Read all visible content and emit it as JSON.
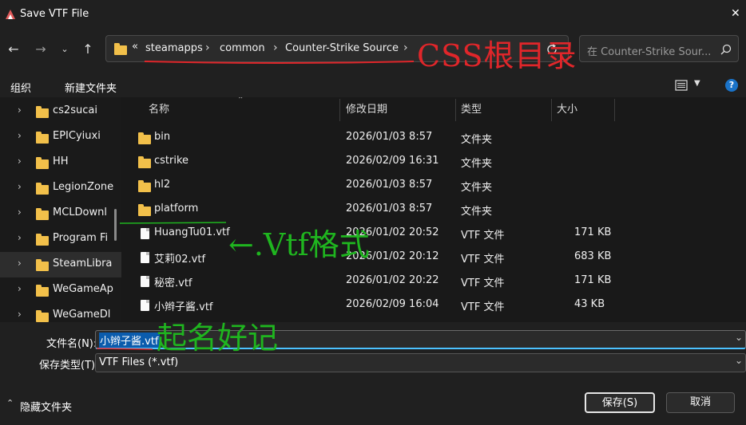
{
  "window": {
    "title": "Save VTF File",
    "close": "✕"
  },
  "nav": {
    "breadcrumbs": [
      "steamapps",
      "common",
      "Counter-Strike Source"
    ],
    "overflow": "«",
    "search_placeholder": "在 Counter-Strike Sour..."
  },
  "toolbar": {
    "organize": "组织",
    "new_folder": "新建文件夹"
  },
  "sidebar": {
    "items": [
      {
        "label": "cs2sucai"
      },
      {
        "label": "EPICyiuxi"
      },
      {
        "label": "HH"
      },
      {
        "label": "LegionZone"
      },
      {
        "label": "MCLDownl"
      },
      {
        "label": "Program Fi"
      },
      {
        "label": "SteamLibra"
      },
      {
        "label": "WeGameAp"
      },
      {
        "label": "WeGameDl"
      }
    ]
  },
  "columns": {
    "name": "名称",
    "date": "修改日期",
    "type": "类型",
    "size": "大小"
  },
  "files": [
    {
      "name": "bin",
      "date": "2026/01/03 8:57",
      "type": "文件夹",
      "size": "",
      "kind": "folder"
    },
    {
      "name": "cstrike",
      "date": "2026/02/09 16:31",
      "type": "文件夹",
      "size": "",
      "kind": "folder"
    },
    {
      "name": "hl2",
      "date": "2026/01/03 8:57",
      "type": "文件夹",
      "size": "",
      "kind": "folder"
    },
    {
      "name": "platform",
      "date": "2026/01/03 8:57",
      "type": "文件夹",
      "size": "",
      "kind": "folder"
    },
    {
      "name": "HuangTu01.vtf",
      "date": "2026/01/02 20:52",
      "type": "VTF 文件",
      "size": "171 KB",
      "kind": "file"
    },
    {
      "name": "艾莉02.vtf",
      "date": "2026/01/02 20:12",
      "type": "VTF 文件",
      "size": "683 KB",
      "kind": "file"
    },
    {
      "name": "秘密.vtf",
      "date": "2026/01/02 20:22",
      "type": "VTF 文件",
      "size": "171 KB",
      "kind": "file"
    },
    {
      "name": "小辫子酱.vtf",
      "date": "2026/02/09 16:04",
      "type": "VTF 文件",
      "size": "43 KB",
      "kind": "file"
    }
  ],
  "form": {
    "filename_label": "文件名(N):",
    "filename_value": "小辫子酱.vtf",
    "filetype_label": "保存类型(T):",
    "filetype_value": "VTF Files (*.vtf)"
  },
  "footer": {
    "hide_folders": "隐藏文件夹",
    "save": "保存(S)",
    "cancel": "取消"
  },
  "annotations": {
    "css_root": "CSS根目录",
    "vtf_format": "←.Vtf格式",
    "name_it": "起名好记"
  },
  "colors": {
    "accent": "#4cc2ff",
    "annotation_red": "#e0262a",
    "annotation_green": "#1fb51f"
  }
}
